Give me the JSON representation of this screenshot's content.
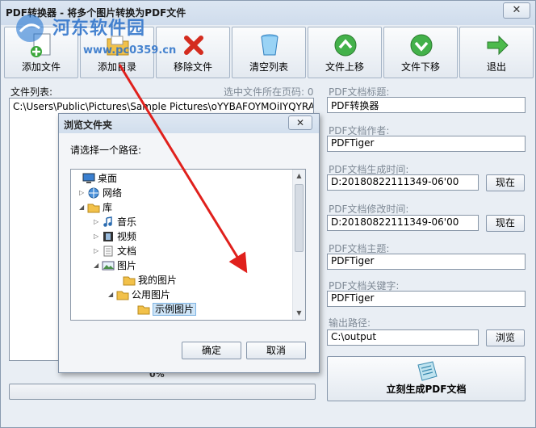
{
  "window": {
    "title": "PDF转换器 - 将多个图片转换为PDF文件",
    "close_label": "✕"
  },
  "watermark": {
    "line1": "河东软件园",
    "line2": "www.pc0359.cn"
  },
  "toolbar": {
    "buttons": [
      {
        "label": "添加文件",
        "icon": "add-file-icon"
      },
      {
        "label": "添加目录",
        "icon": "add-folder-icon"
      },
      {
        "label": "移除文件",
        "icon": "remove-icon"
      },
      {
        "label": "清空列表",
        "icon": "clear-list-icon"
      },
      {
        "label": "文件上移",
        "icon": "move-up-icon"
      },
      {
        "label": "文件下移",
        "icon": "move-down-icon"
      },
      {
        "label": "退出",
        "icon": "exit-icon"
      }
    ]
  },
  "file_list": {
    "label": "文件列表:",
    "page_info": "选中文件所在页码: 0",
    "items": [
      "C:\\Users\\Public\\Pictures\\Sample Pictures\\oYYBAFOYMOiIYQYRAALb"
    ]
  },
  "pdf": {
    "title_label": "PDF文档标题:",
    "title_value": "PDF转换器",
    "author_label": "PDF文档作者:",
    "author_value": "PDFTiger",
    "created_label": "PDF文档生成时间:",
    "created_value": "D:20180822111349-06'00",
    "modified_label": "PDF文档修改时间:",
    "modified_value": "D:20180822111349-06'00",
    "now_label": "现在",
    "subject_label": "PDF文档主题:",
    "subject_value": "PDFTiger",
    "keywords_label": "PDF文档关键字:",
    "keywords_value": "PDFTiger",
    "output_label": "输出路径:",
    "output_value": "C:\\output",
    "browse_label": "浏览",
    "generate_label": "立刻生成PDF文档"
  },
  "progress": {
    "percent_text": "0%",
    "value": 0
  },
  "dialog": {
    "title": "浏览文件夹",
    "close_label": "✕",
    "prompt": "请选择一个路径:",
    "tree": [
      {
        "label": "桌面",
        "icon": "desktop-icon",
        "toggle": ""
      },
      {
        "label": "网络",
        "icon": "network-icon",
        "toggle": "▷"
      },
      {
        "label": "库",
        "icon": "library-icon",
        "toggle": "◢"
      },
      {
        "label": "音乐",
        "icon": "music-icon",
        "toggle": "▷"
      },
      {
        "label": "视频",
        "icon": "video-icon",
        "toggle": "▷"
      },
      {
        "label": "文档",
        "icon": "document-icon",
        "toggle": "▷"
      },
      {
        "label": "图片",
        "icon": "pictures-icon",
        "toggle": "◢"
      },
      {
        "label": "我的图片",
        "icon": "folder-icon",
        "toggle": ""
      },
      {
        "label": "公用图片",
        "icon": "folder-icon",
        "toggle": "◢"
      },
      {
        "label": "示例图片",
        "icon": "folder-icon",
        "toggle": ""
      }
    ],
    "ok_label": "确定",
    "cancel_label": "取消"
  },
  "colors": {
    "accent_arrow": "#e0201c",
    "selection": "#cde4f7"
  }
}
